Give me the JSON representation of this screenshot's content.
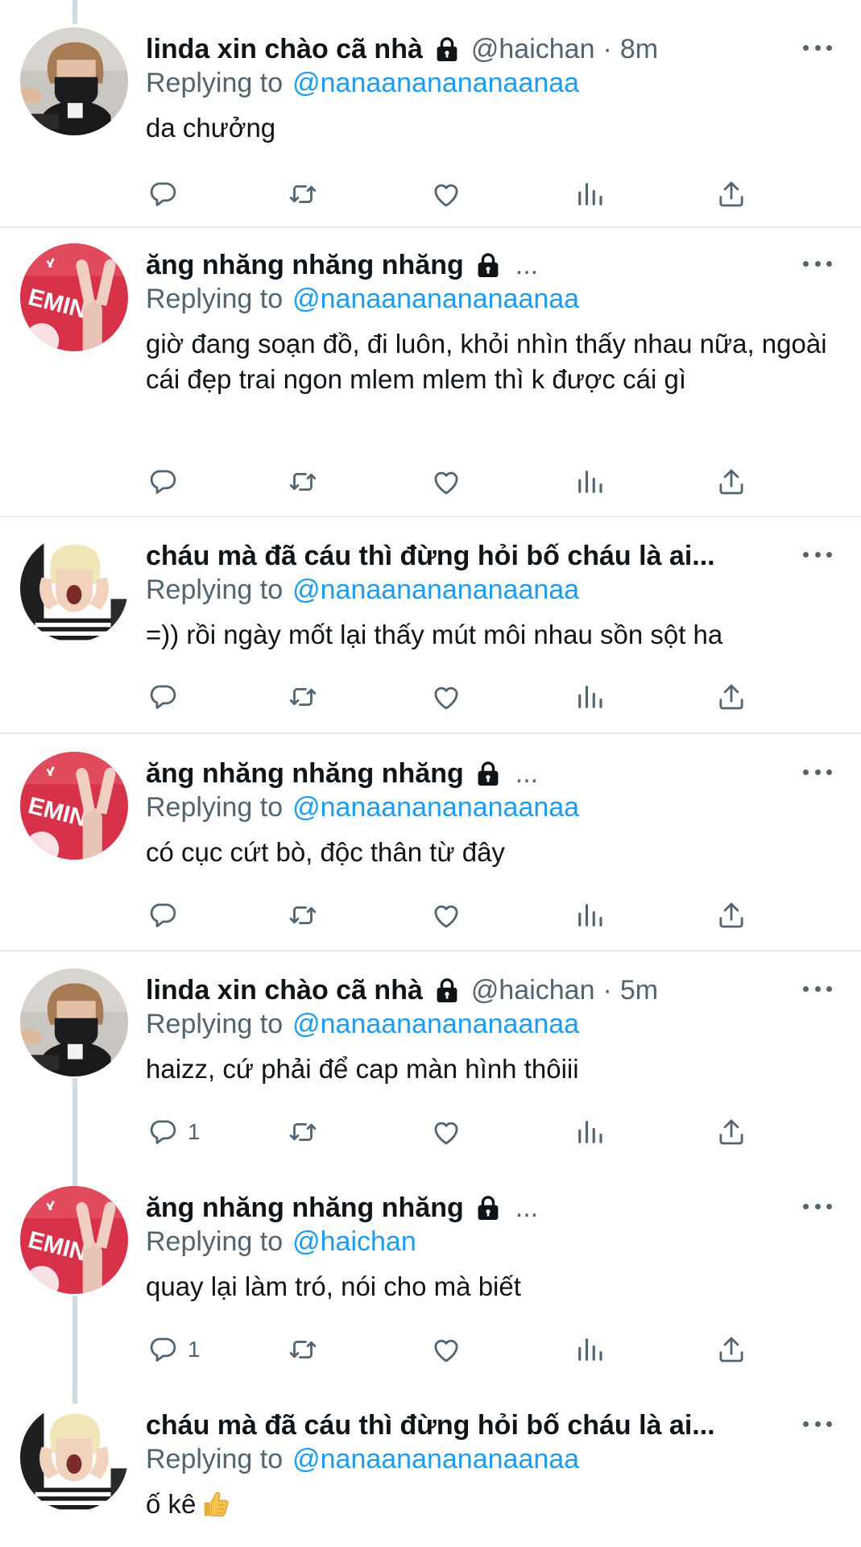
{
  "feed": {
    "tweets": [
      {
        "name": "linda xin chào cã nhà",
        "locked": true,
        "handle": "@haichan",
        "time": "8m",
        "truncated": false,
        "replying_prefix": "Replying to",
        "replying_to": "@nanaananananaanaa",
        "text": "da chưởng",
        "reply_count": "",
        "avatar": "masked-person-avatar"
      },
      {
        "name": "ăng nhăng nhăng nhăng",
        "locked": true,
        "handle": "",
        "time": "",
        "truncated": true,
        "ellipsis": "...",
        "replying_prefix": "Replying to",
        "replying_to": "@nanaananananaanaa",
        "text": "giờ đang soạn đồ, đi luôn, khỏi nhìn thấy nhau nữa, ngoài cái đẹp trai ngon mlem mlem thì k được cái gì",
        "reply_count": "",
        "avatar": "peace-sign-avatar"
      },
      {
        "name": "cháu mà đã cáu thì đừng hỏi bố cháu là ai...",
        "locked": false,
        "handle": "",
        "time": "",
        "truncated": false,
        "replying_prefix": "Replying to",
        "replying_to": "@nanaananananaanaa",
        "text": "=)) rồi ngày mốt lại thấy mút môi nhau sồn sột ha",
        "reply_count": "",
        "avatar": "screaming-person-avatar"
      },
      {
        "name": "ăng nhăng nhăng nhăng",
        "locked": true,
        "handle": "",
        "time": "",
        "truncated": true,
        "ellipsis": "...",
        "replying_prefix": "Replying to",
        "replying_to": "@nanaananananaanaa",
        "text": "có cục cứt bò, độc thân từ đây",
        "reply_count": "",
        "avatar": "peace-sign-avatar"
      },
      {
        "name": "linda xin chào cã nhà",
        "locked": true,
        "handle": "@haichan",
        "time": "5m",
        "truncated": false,
        "replying_prefix": "Replying to",
        "replying_to": "@nanaananananaanaa",
        "text": "haizz, cứ phải để cap màn hình thôiii",
        "reply_count": "1",
        "avatar": "masked-person-avatar"
      },
      {
        "name": "ăng nhăng nhăng nhăng",
        "locked": true,
        "handle": "",
        "time": "",
        "truncated": true,
        "ellipsis": "...",
        "replying_prefix": "Replying to",
        "replying_to": "@haichan",
        "text": "quay lại làm tró, nói cho mà biết",
        "reply_count": "1",
        "avatar": "peace-sign-avatar"
      },
      {
        "name": "cháu mà đã cáu thì đừng hỏi bố cháu là ai...",
        "locked": false,
        "handle": "",
        "time": "",
        "truncated": false,
        "replying_prefix": "Replying to",
        "replying_to": "@nanaananananaanaa",
        "text": "ố kê",
        "emoji": "thumbs-up",
        "reply_count": "",
        "avatar": "screaming-person-avatar"
      }
    ]
  },
  "colors": {
    "text": "#0f1419",
    "secondary": "#536471",
    "link": "#1d9bf0",
    "divider": "#e7e9eb",
    "thread_line": "#cfd9de"
  },
  "icons": [
    "reply-icon",
    "retweet-icon",
    "like-icon",
    "analytics-icon",
    "share-icon",
    "lock-icon",
    "more-icon"
  ]
}
